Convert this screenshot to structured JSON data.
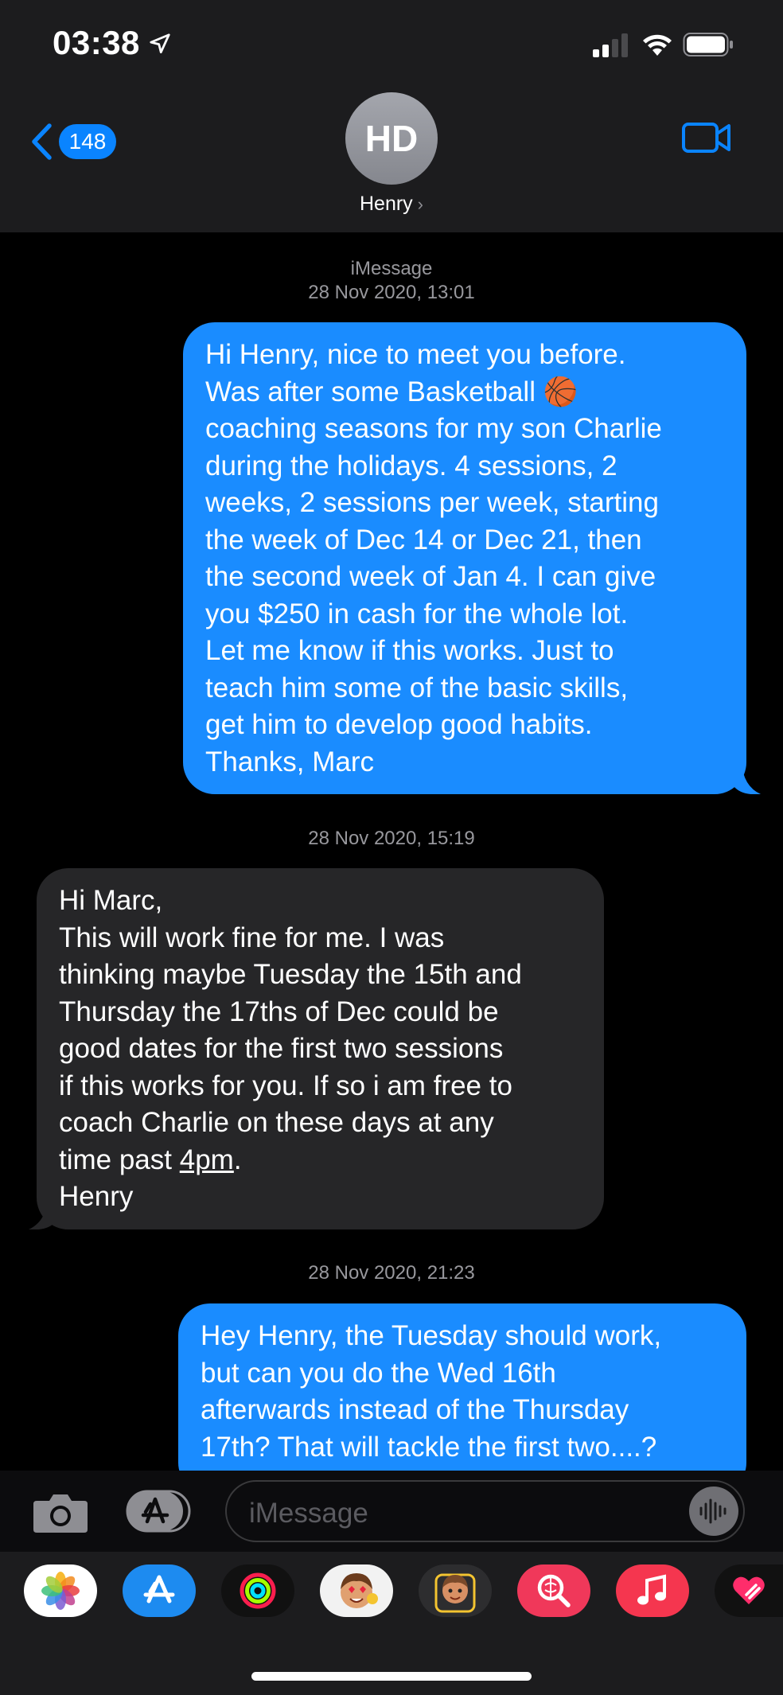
{
  "status_bar": {
    "time": "03:38"
  },
  "header": {
    "back_count": "148",
    "avatar_initials": "HD",
    "contact_name": "Henry"
  },
  "conversation": {
    "service_label": "iMessage",
    "messages": [
      {
        "timestamp": "28 Nov 2020, 13:01",
        "direction": "outgoing",
        "lines": [
          "Hi Henry, nice to meet you before.",
          "Was after some Basketball 🏀",
          "coaching seasons for my son Charlie",
          "during the holidays. 4 sessions, 2",
          "weeks, 2 sessions per week, starting",
          "the week of Dec 14 or Dec 21, then",
          "the second week of Jan 4.  I can give",
          "you $250 in cash for the whole lot.",
          "Let me know if this works. Just to",
          "teach him some of the basic skills,",
          "get him to develop good habits.",
          "Thanks, Marc"
        ]
      },
      {
        "timestamp": "28 Nov 2020, 15:19",
        "direction": "incoming",
        "lines": [
          "Hi Marc,",
          "This will work fine for me. I was",
          "thinking maybe Tuesday the 15th and",
          "Thursday the 17ths of Dec could be",
          "good dates for the first two sessions",
          "if this works for you. If so i am free to",
          "coach Charlie on these days at any",
          "time past ",
          "4pm",
          ".",
          "Henry"
        ]
      },
      {
        "timestamp": "28 Nov 2020, 21:23",
        "direction": "outgoing",
        "lines": [
          "Hey Henry, the Tuesday should work,",
          "but can you do the Wed 16th",
          "afterwards instead of the Thursday",
          "17th? That will tackle the first two....?"
        ]
      }
    ]
  },
  "input": {
    "placeholder": "iMessage"
  },
  "app_drawer": {
    "apps": [
      "photos-app-icon",
      "app-store-icon",
      "activity-app-icon",
      "memoji-stickers-icon",
      "memoji-icon",
      "image-search-icon",
      "music-app-icon",
      "digital-touch-icon"
    ]
  },
  "colors": {
    "outgoing_bubble": "#1a8cff",
    "incoming_bubble": "#262628",
    "accent": "#0a84ff"
  }
}
